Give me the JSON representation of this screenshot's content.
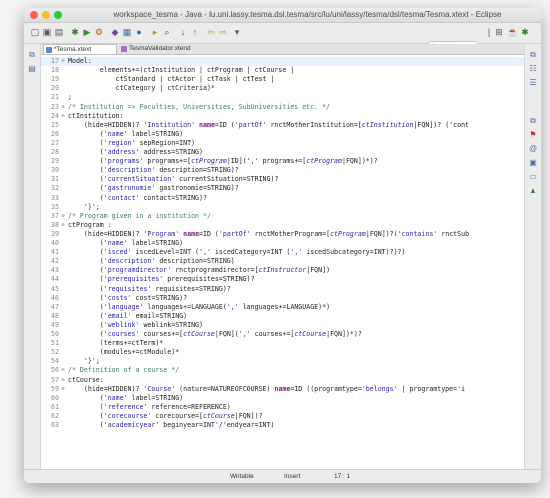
{
  "window": {
    "title": "workspace_tesma - Java - lu.uni.lassy.tesma.dsl.tesma/src/lu/uni/lassy/tesma/dsl/tesma/Tesma.xtext - Eclipse"
  },
  "toolbar": {
    "quick_access_placeholder": "Quick Access"
  },
  "tabs": [
    {
      "label": "*Tesma.xtext",
      "active": true
    },
    {
      "label": "TesmaValidator.xtend",
      "active": false
    }
  ],
  "editor": {
    "lines": [
      {
        "n": "17",
        "code": "Model:"
      },
      {
        "n": "18",
        "code": "        elements+=(ctInstitution | ctProgram | ctCourse |"
      },
      {
        "n": "19",
        "code": "            ctStandard | ctActor | ctTask | ctTest |"
      },
      {
        "n": "20",
        "code": "            ctCategory | ctCriteria)*"
      },
      {
        "n": "21",
        "code": ";"
      },
      {
        "n": "23",
        "code": "/* Institution => Faculties, Universities, SubUniversities etc. */"
      },
      {
        "n": "24",
        "code": "ctInstitution:"
      },
      {
        "n": "25",
        "code": "    (hide=HIDDEN)? 'Institution' name=ID ('partOf' rnctMotherInstitution=[ctInstitution|FQN])? ('cont"
      },
      {
        "n": "26",
        "code": "        ('name' label=STRING)"
      },
      {
        "n": "27",
        "code": "        ('region' sepRegion=INT)"
      },
      {
        "n": "28",
        "code": "        ('address' address=STRING)"
      },
      {
        "n": "29",
        "code": "        ('programs' programs+=[ctProgram|ID](',' programs+=[ctProgram|FQN])*)?"
      },
      {
        "n": "30",
        "code": "        ('description' description=STRING)?"
      },
      {
        "n": "31",
        "code": "        ('currentSituation' currentSituation=STRING)?"
      },
      {
        "n": "32",
        "code": "        ('gastronomie' gastronomie=STRING)?"
      },
      {
        "n": "33",
        "code": "        ('contact' contact=STRING)?"
      },
      {
        "n": "35",
        "code": "    '}';"
      },
      {
        "n": "37",
        "code": "/* Program given in a institution */"
      },
      {
        "n": "38",
        "code": "ctProgram :"
      },
      {
        "n": "39",
        "code": "    (hide=HIDDEN)? 'Program' name=ID ('partOf' rnctMotherProgram=[ctProgram|FQN])?('contains' rnctSub"
      },
      {
        "n": "40",
        "code": "        ('name' label=STRING)"
      },
      {
        "n": "41",
        "code": "        ('isced' iscedLevel=INT (',' iscedCategory=INT (',' iscedSubcategory=INT)?)?)"
      },
      {
        "n": "42",
        "code": "        ('description' description=STRING)"
      },
      {
        "n": "43",
        "code": "        ('programdirector' rnctprogramdirector=[ctInstructor|FQN])"
      },
      {
        "n": "44",
        "code": "        ('prerequisites' prerequisites=STRING)?"
      },
      {
        "n": "45",
        "code": "        ('requisites' requisites=STRING)?"
      },
      {
        "n": "46",
        "code": "        ('costs' cost=STRING)?"
      },
      {
        "n": "47",
        "code": "        ('language' languages+=LANGUAGE(',' languages+=LANGUAGE)*)"
      },
      {
        "n": "48",
        "code": "        ('email' email=STRING)"
      },
      {
        "n": "49",
        "code": "        ('weblink' weblink=STRING)"
      },
      {
        "n": "50",
        "code": "        ('courses' courses+=[ctCourse|FQN](',' courses+=[ctCourse|FQN])*)?"
      },
      {
        "n": "51",
        "code": "        (terms+=ctTerm)*"
      },
      {
        "n": "52",
        "code": "        (modules+=ctModule)*"
      },
      {
        "n": "54",
        "code": "    '}';"
      },
      {
        "n": "56",
        "code": "/* Definition of a course */"
      },
      {
        "n": "57",
        "code": "ctCourse:"
      },
      {
        "n": "59",
        "code": "    (hide=HIDDEN)? 'Course' (nature=NATUREOFCOURSE) name=ID ((programtype='belongs' | programtype='i"
      },
      {
        "n": "60",
        "code": "        ('name' label=STRING)"
      },
      {
        "n": "61",
        "code": "        ('reference' reference=REFERENCE)"
      },
      {
        "n": "62",
        "code": "        ('corecourse' corecourse=[ctCourse|FQN])?"
      },
      {
        "n": "63",
        "code": "        ('academicyear' beginyear=INT'/'endyear=INT)"
      }
    ]
  },
  "status": {
    "writable": "Writable",
    "insert": "Insert",
    "position": "17 : 1"
  }
}
